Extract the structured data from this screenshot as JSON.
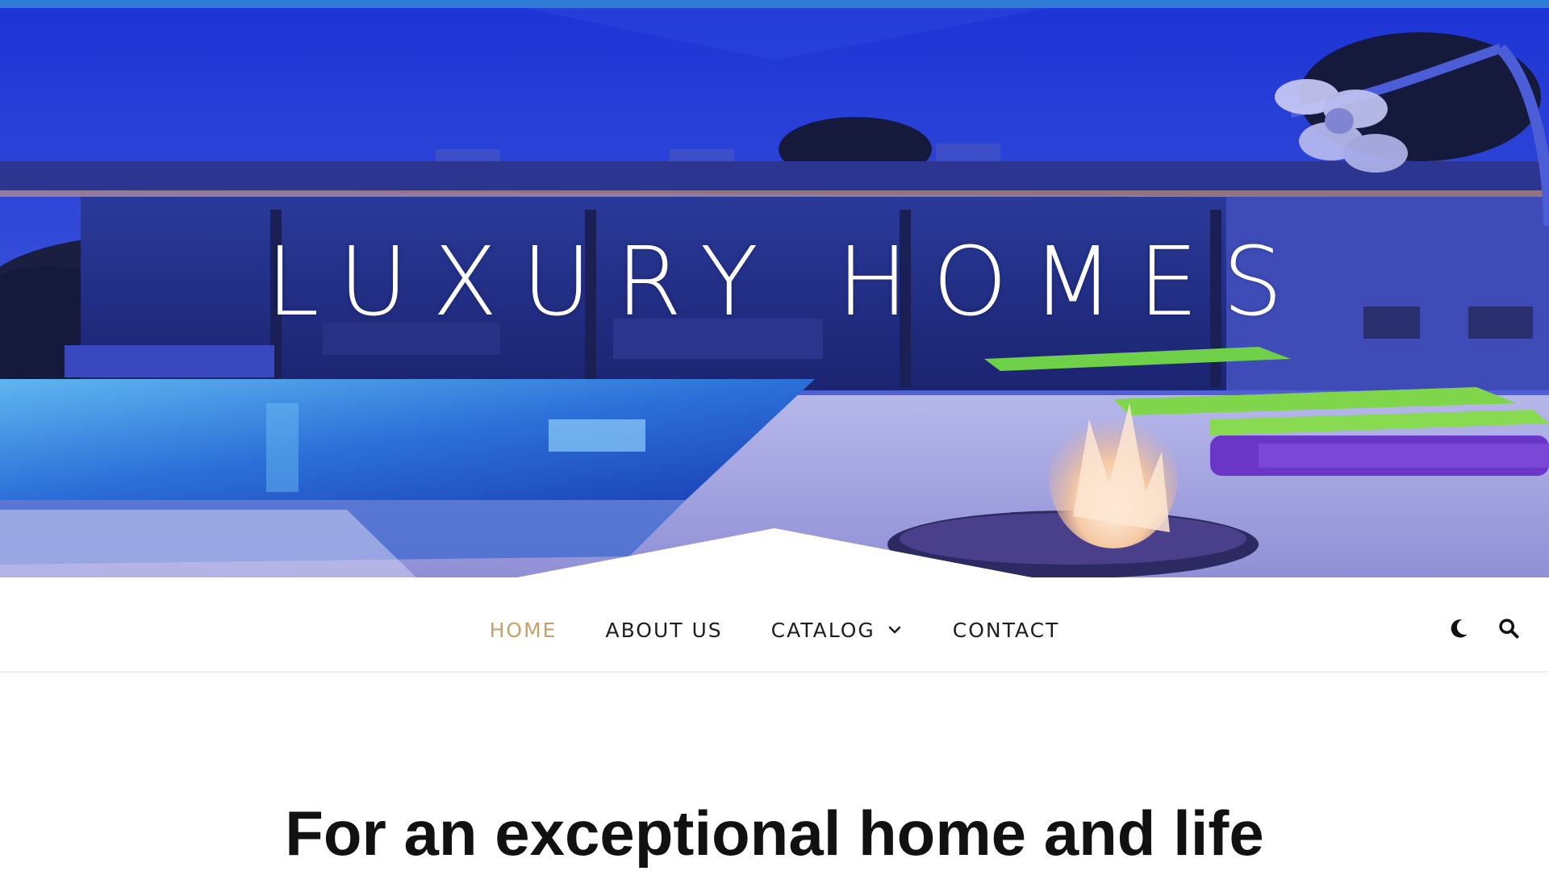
{
  "site": {
    "title": "LUXURY HOMES"
  },
  "nav": {
    "items": [
      {
        "label": "HOME",
        "active": true
      },
      {
        "label": "ABOUT US",
        "active": false
      },
      {
        "label": "CATALOG",
        "active": false,
        "has_dropdown": true
      },
      {
        "label": "CONTACT",
        "active": false
      }
    ],
    "tools": [
      {
        "icon": "moon-icon",
        "purpose": "dark mode toggle"
      },
      {
        "icon": "search-icon",
        "purpose": "search"
      }
    ]
  },
  "main": {
    "headline": "For an exceptional home and life"
  },
  "colors": {
    "accent": "#c7a06c",
    "nav_text": "#1e1e1e",
    "headline": "#111111",
    "hero_sky": "#2a3fd8"
  }
}
